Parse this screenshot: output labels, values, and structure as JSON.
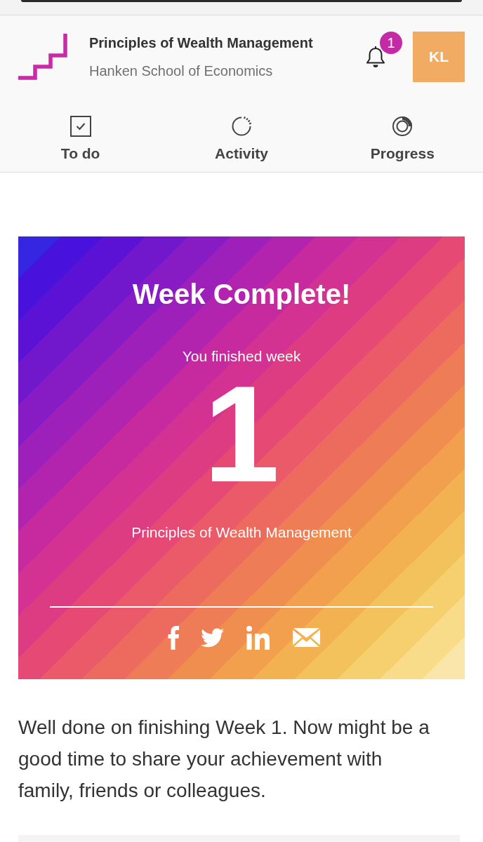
{
  "header": {
    "course_title": "Principles of Wealth Management",
    "institution": "Hanken School of Economics",
    "notification_count": "1",
    "avatar_initials": "KL"
  },
  "tabs": [
    {
      "kind": "todo",
      "label": "To do",
      "selected": false
    },
    {
      "kind": "activity",
      "label": "Activity",
      "selected": false
    },
    {
      "kind": "progress",
      "label": "Progress",
      "selected": false
    }
  ],
  "card": {
    "title": "Week Complete!",
    "subtitle": "You finished week",
    "week_number": "1",
    "course_title": "Principles of Wealth Management",
    "share_links": [
      {
        "kind": "facebook"
      },
      {
        "kind": "twitter"
      },
      {
        "kind": "linkedin"
      },
      {
        "kind": "email"
      }
    ]
  },
  "message": "Well done on finishing Week 1. Now might be a good time to share your achievement with family, friends or colleagues."
}
